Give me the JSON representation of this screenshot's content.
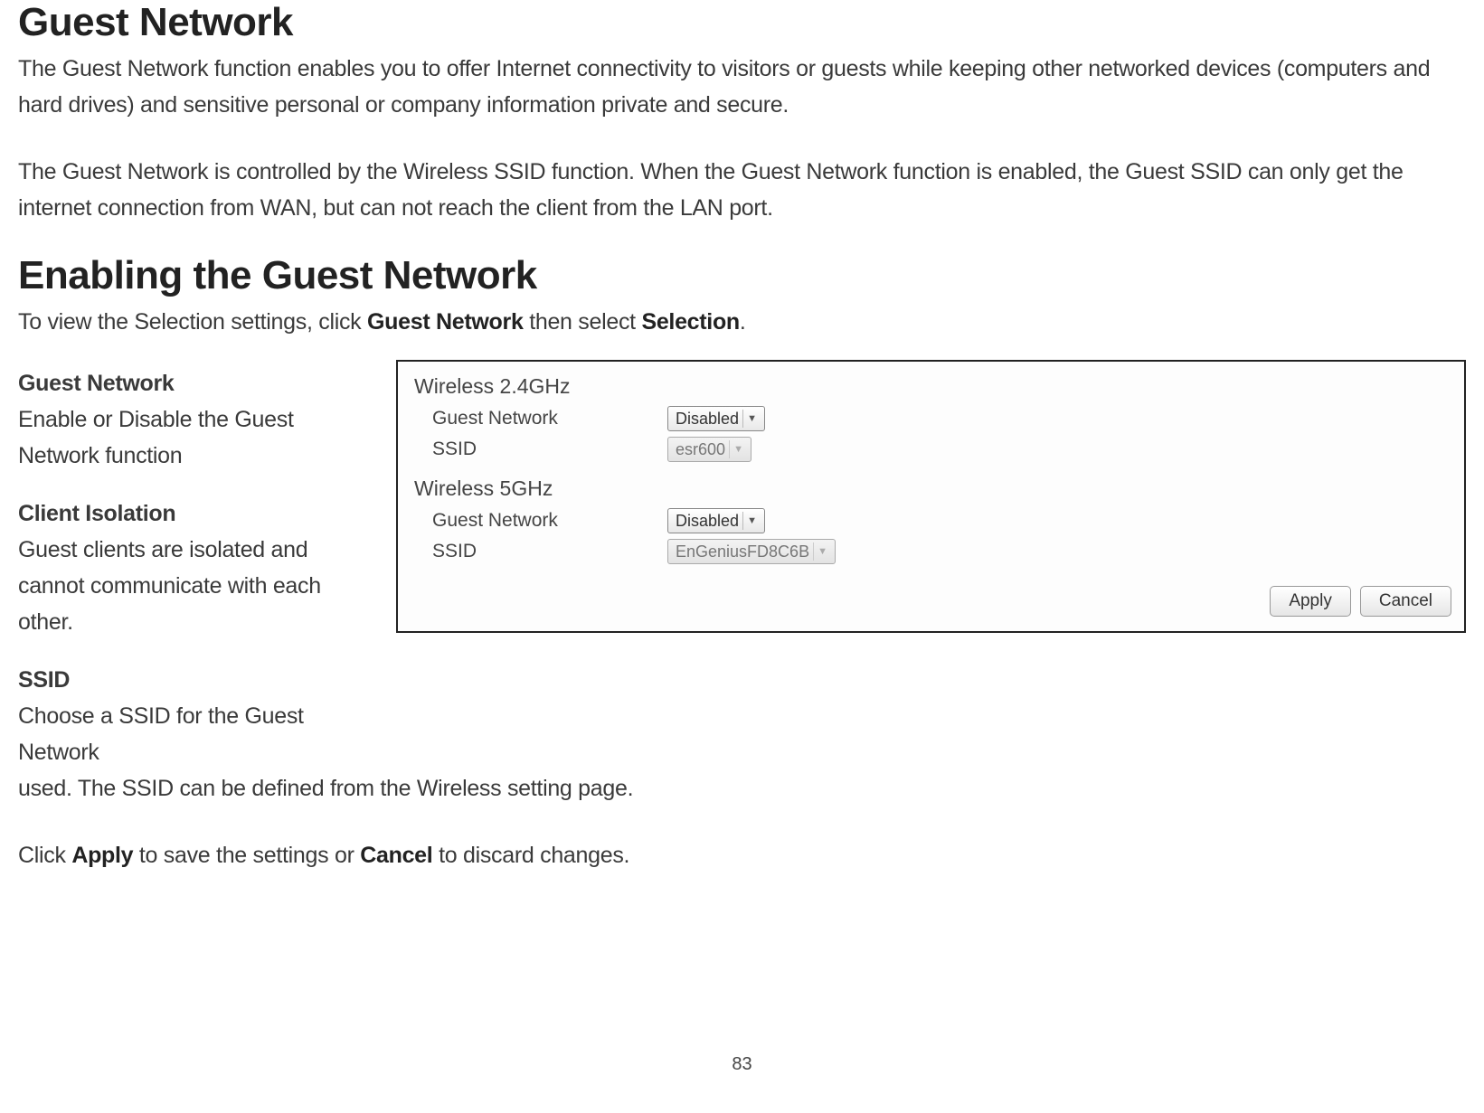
{
  "headings": {
    "main": "Guest Network",
    "enabling": "Enabling the Guest Network"
  },
  "intro": {
    "p1": "The Guest Network function enables you to offer Internet connectivity to visitors or guests while keeping other networked devices (computers and hard drives) and sensitive personal or company information private and secure.",
    "p2": "The Guest Network is controlled by the Wireless SSID function. When the Guest Network function is enabled, the Guest SSID can only get the internet connection from WAN, but can not reach the client from the LAN port."
  },
  "selection_instr": {
    "pre": "To view the Selection settings, click ",
    "b1": "Guest Network",
    "mid": " then select ",
    "b2": "Selection",
    "post": "."
  },
  "defs": {
    "gn_title": "Guest Network",
    "gn_body": "Enable or Disable the Guest Network function",
    "ci_title": "Client Isolation",
    "ci_body": "Guest clients are isolated and cannot communicate with each other.",
    "ssid_title": "SSID",
    "ssid_body_left": "Choose a SSID for the Guest Network"
  },
  "ssid_cont": "used. The SSID can be defined from the Wireless setting page.",
  "apply_instr": {
    "pre": "Click ",
    "b1": "Apply",
    "mid": " to save the settings or ",
    "b2": "Cancel",
    "post": " to discard changes."
  },
  "panel": {
    "section24": "Wireless 2.4GHz",
    "section5": "Wireless 5GHz",
    "label_gn": "Guest Network",
    "label_ssid": "SSID",
    "gn24_value": "Disabled",
    "ssid24_value": "esr600",
    "gn5_value": "Disabled",
    "ssid5_value": "EnGeniusFD8C6B",
    "apply": "Apply",
    "cancel": "Cancel"
  },
  "page_number": "83"
}
